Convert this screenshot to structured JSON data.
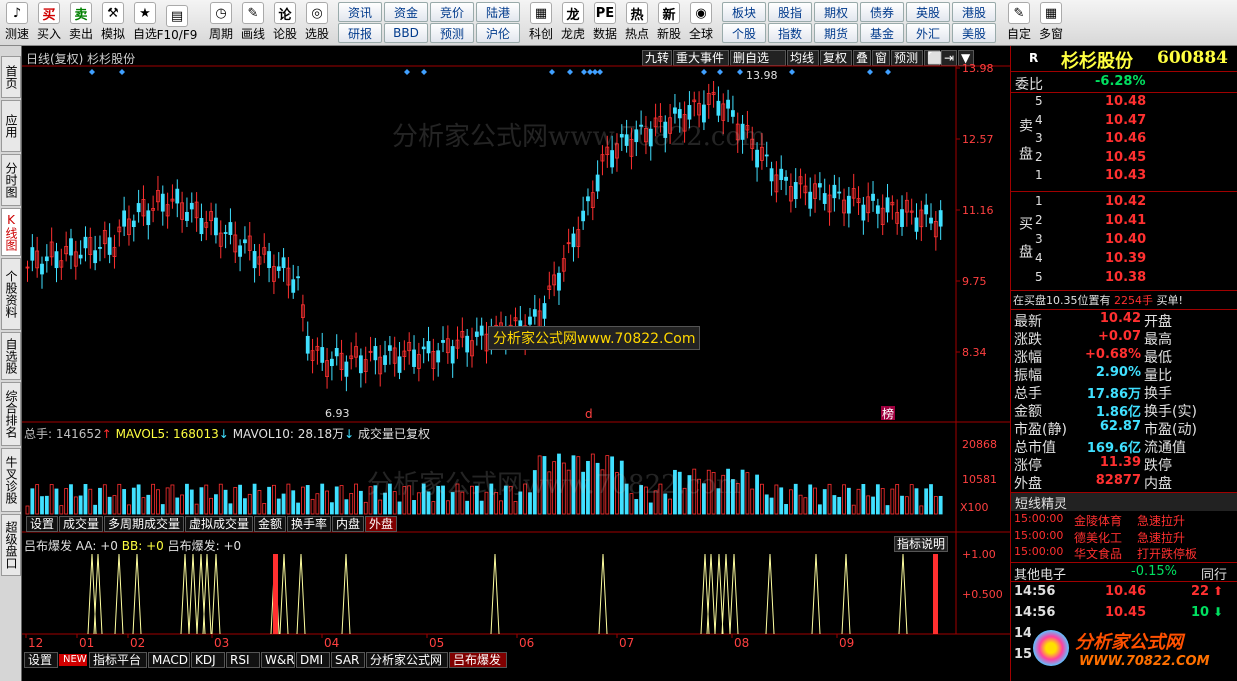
{
  "toolbar": {
    "buttons": [
      {
        "label": "测速",
        "icon": "♪"
      },
      {
        "label": "买入",
        "icon": "买"
      },
      {
        "label": "卖出",
        "icon": "卖"
      },
      {
        "label": "模拟",
        "icon": "⚒"
      },
      {
        "label": "自选",
        "icon": "★"
      },
      {
        "label": "F10/F9",
        "icon": "▤"
      },
      {
        "label": "周期",
        "icon": "◷"
      },
      {
        "label": "画线",
        "icon": "✎"
      },
      {
        "label": "论股",
        "icon": "论"
      },
      {
        "label": "选股",
        "icon": "◎"
      }
    ],
    "grid1": [
      [
        "资讯",
        "研报"
      ],
      [
        "资金",
        "BBD"
      ],
      [
        "竞价",
        "预测"
      ],
      [
        "陆港",
        "沪伦"
      ]
    ],
    "buttons2": [
      {
        "label": "科创",
        "icon": "▦"
      },
      {
        "label": "龙虎",
        "icon": "龙"
      },
      {
        "label": "数据",
        "icon": "PE"
      },
      {
        "label": "热点",
        "icon": "热"
      },
      {
        "label": "新股",
        "icon": "新"
      },
      {
        "label": "全球",
        "icon": "◉"
      }
    ],
    "grid2": [
      [
        "板块",
        "个股"
      ],
      [
        "股指",
        "指数"
      ],
      [
        "期权",
        "期货"
      ],
      [
        "债券",
        "基金"
      ],
      [
        "英股",
        "外汇"
      ],
      [
        "港股",
        "美股"
      ]
    ],
    "buttons3": [
      {
        "label": "自定",
        "icon": "✎"
      },
      {
        "label": "多窗",
        "icon": "▦"
      }
    ]
  },
  "left_tabs": [
    "首页",
    "应用",
    "分时图",
    "K线图",
    "个股资料",
    "自选股",
    "综合排名",
    "牛叉诊股",
    "超级盘口"
  ],
  "chart": {
    "title": "日线(复权) 杉杉股份",
    "top_buttons": [
      "九转",
      "重大事件",
      "删自选",
      "均线",
      "复权",
      "叠",
      "窗",
      "预测",
      "⬜",
      "⇥",
      "▼"
    ],
    "price_axis": [
      "13.98",
      "12.57",
      "11.16",
      "9.75",
      "8.34"
    ],
    "high_label": "13.98",
    "low_label": "6.93",
    "watermark1": "分析家公式网www.70822.com",
    "watermark_box": "分析家公式网www.70822.Com",
    "watermark2": "分析家公式网www.70822.com",
    "marker_d": "d",
    "marker_bang": "榜",
    "volume": {
      "label_total": "总手: 141652",
      "label_ma5": "MAVOL5: 168013",
      "label_ma10": "MAVOL10: 28.18万",
      "label_fq": "成交量已复权",
      "axis": [
        "20868",
        "10581",
        "X100"
      ]
    },
    "vol_tabs": [
      "设置",
      "成交量",
      "多周期成交量",
      "虚拟成交量",
      "金额",
      "换手率",
      "内盘",
      "外盘"
    ],
    "indicator": {
      "label": "吕布爆发",
      "aa": "AA: +0",
      "bb": "BB: +0",
      "lbbf": "吕布爆发: +0",
      "explain": "指标说明",
      "axis": [
        "+1.00",
        "+0.500"
      ]
    },
    "months": [
      "12",
      "01",
      "02",
      "03",
      "04",
      "05",
      "06",
      "07",
      "08",
      "09"
    ],
    "bottom_tabs": [
      "设置",
      "NEW",
      "指标平台",
      "MACD",
      "KDJ",
      "RSI",
      "W&R",
      "DMI",
      "SAR",
      "分析家公式网",
      "吕布爆发"
    ]
  },
  "quote": {
    "r_label": "R",
    "name": "杉杉股份",
    "code": "600884",
    "weibi_label": "委比",
    "weibi": "-6.28%",
    "sell_label": "卖盘",
    "buy_label": "买盘",
    "sell": [
      {
        "n": "5",
        "price": "10.48"
      },
      {
        "n": "4",
        "price": "10.47"
      },
      {
        "n": "3",
        "price": "10.46"
      },
      {
        "n": "2",
        "price": "10.45"
      },
      {
        "n": "1",
        "price": "10.43"
      }
    ],
    "buy": [
      {
        "n": "1",
        "price": "10.42"
      },
      {
        "n": "2",
        "price": "10.41"
      },
      {
        "n": "3",
        "price": "10.40"
      },
      {
        "n": "4",
        "price": "10.39"
      },
      {
        "n": "5",
        "price": "10.38"
      }
    ],
    "position_text": "在买盘10.35位置有",
    "position_qty": "2254手",
    "position_tip": "买单!",
    "stats": [
      {
        "l": "最新",
        "v": "10.42",
        "r": "开盘"
      },
      {
        "l": "涨跌",
        "v": "+0.07",
        "r": "最高"
      },
      {
        "l": "涨幅",
        "v": "+0.68%",
        "r": "最低"
      },
      {
        "l": "振幅",
        "v": "2.90%",
        "r": "量比"
      },
      {
        "l": "总手",
        "v": "17.86万",
        "r": "换手"
      },
      {
        "l": "金额",
        "v": "1.86亿",
        "r": "换手(实)"
      },
      {
        "l": "市盈(静)",
        "v": "62.87",
        "r": "市盈(动)"
      },
      {
        "l": "总市值",
        "v": "169.6亿",
        "r": "流通值"
      },
      {
        "l": "涨停",
        "v": "11.39",
        "r": "跌停"
      },
      {
        "l": "外盘",
        "v": "82877",
        "r": "内盘"
      }
    ],
    "elf_title": "短线精灵",
    "elf": [
      {
        "t": "15:00:00",
        "name": "金陵体育",
        "ev": "急速拉升"
      },
      {
        "t": "15:00:00",
        "name": "德美化工",
        "ev": "急速拉升"
      },
      {
        "t": "15:00:00",
        "name": "华文食品",
        "ev": "打开跌停板"
      }
    ],
    "sector": "其他电子",
    "sector_pct": "-0.15%",
    "sector_peer": "同行",
    "ticks": [
      {
        "t": "14:56",
        "p": "10.46",
        "q": "22",
        "dir": "up"
      },
      {
        "t": "14:56",
        "p": "10.45",
        "q": "10",
        "dir": "down"
      },
      {
        "t": "14:56",
        "p": "",
        "q": "",
        "dir": ""
      },
      {
        "t": "15:",
        "p": "",
        "q": "",
        "dir": ""
      }
    ],
    "logo_text": "分析家公式网",
    "logo_url": "WWW.70822.COM"
  },
  "colors": {
    "up": "#ff3030",
    "down": "#40e0ff",
    "frame": "#a00000",
    "ma5": "#ffff40",
    "ma10": "#ffffff"
  }
}
